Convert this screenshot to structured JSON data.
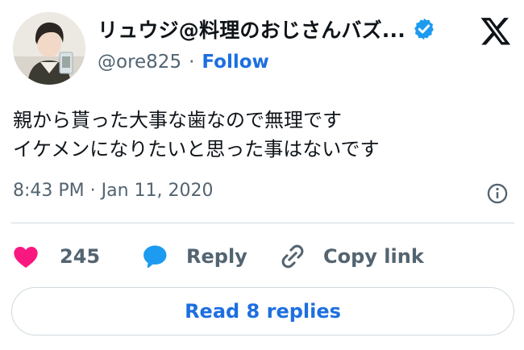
{
  "author": {
    "display_name": "リュウジ@料理のおじさんバズ...",
    "handle": "@ore825",
    "separator": "·",
    "follow_label": "Follow",
    "verified_color": "#1d9bf0"
  },
  "tweet": {
    "lines": [
      "親から貰った大事な歯なので無理です",
      "イケメンになりたいと思った事はないです"
    ],
    "timestamp": "8:43 PM · Jan 11, 2020"
  },
  "actions": {
    "like_count": "245",
    "reply_label": "Reply",
    "copy_label": "Copy link"
  },
  "footer": {
    "read_replies_label": "Read 8 replies"
  },
  "colors": {
    "like": "#f91880",
    "reply": "#1d9bf0",
    "link": "#1d6fe0",
    "muted": "#536471"
  },
  "icons": [
    "avatar",
    "verified-badge-icon",
    "x-logo-icon",
    "info-icon",
    "heart-icon",
    "speech-bubble-icon",
    "link-icon"
  ]
}
